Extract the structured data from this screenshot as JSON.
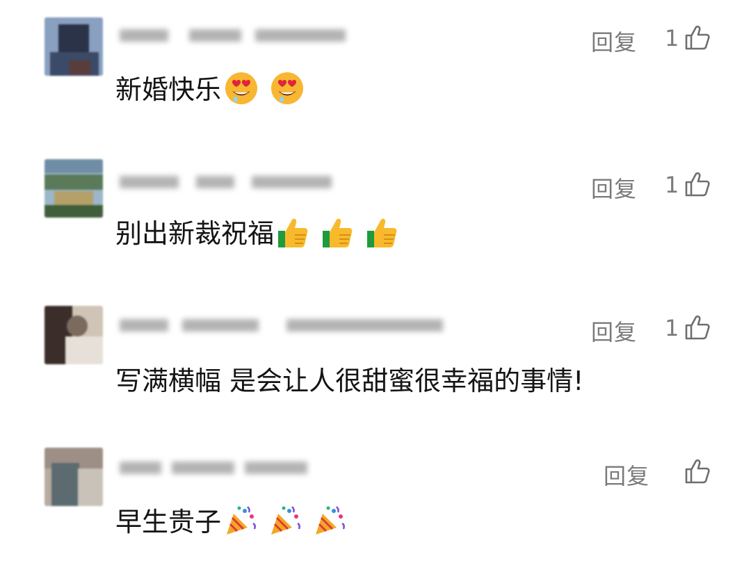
{
  "comments": [
    {
      "reply_label": "回复",
      "like_count": "1",
      "text": "新婚快乐",
      "emoji_icon": "heart-eyes-emoji",
      "emoji_count": 2,
      "avatar_colors": [
        "#3b4a66",
        "#8aa0c0",
        "#1f2533",
        "#c8cbd6",
        "#5a3d3a"
      ]
    },
    {
      "reply_label": "回复",
      "like_count": "1",
      "text": "别出新裁祝福",
      "emoji_icon": "thumbs-up-emoji",
      "emoji_count": 3,
      "avatar_colors": [
        "#5a7a5a",
        "#9cb7c9",
        "#3f5f3a",
        "#6f8ea6",
        "#b5a06a"
      ]
    },
    {
      "reply_label": "回复",
      "like_count": "1",
      "text": "写满横幅 是会让人很甜蜜很幸福的事情!",
      "emoji_icon": "",
      "emoji_count": 0,
      "avatar_colors": [
        "#3b2d2a",
        "#e6e0d8",
        "#7b6a5e",
        "#cfc4b6",
        "#2a2422"
      ]
    },
    {
      "reply_label": "回复",
      "like_count": "",
      "text": "早生贵子",
      "emoji_icon": "party-popper-emoji",
      "emoji_count": 3,
      "avatar_colors": [
        "#7a8a8e",
        "#b8aca0",
        "#5b6b70",
        "#9e8f86",
        "#c9c2b9"
      ]
    }
  ]
}
